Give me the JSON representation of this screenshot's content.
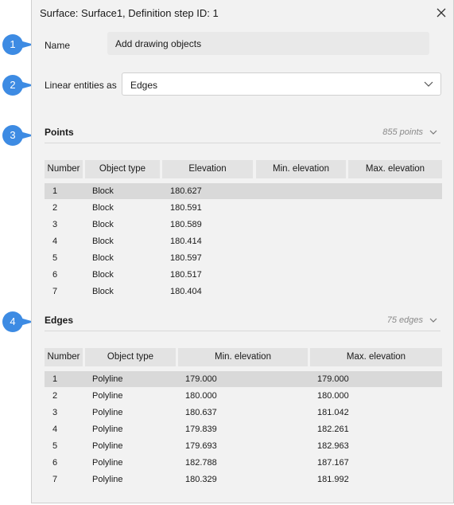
{
  "dialog": {
    "title": "Surface: Surface1, Definition step ID: 1",
    "name_label": "Name",
    "name_value": "Add drawing objects",
    "linear_label": "Linear entities as",
    "linear_value": "Edges"
  },
  "callouts": [
    "1",
    "2",
    "3",
    "4"
  ],
  "points": {
    "title": "Points",
    "count": "855 points",
    "columns": [
      "Number",
      "Object type",
      "Elevation",
      "Min. elevation",
      "Max. elevation"
    ],
    "rows": [
      [
        "1",
        "Block",
        "180.627"
      ],
      [
        "2",
        "Block",
        "180.591"
      ],
      [
        "3",
        "Block",
        "180.589"
      ],
      [
        "4",
        "Block",
        "180.414"
      ],
      [
        "5",
        "Block",
        "180.597"
      ],
      [
        "6",
        "Block",
        "180.517"
      ],
      [
        "7",
        "Block",
        "180.404"
      ]
    ]
  },
  "edges": {
    "title": "Edges",
    "count": "75 edges",
    "columns": [
      "Number",
      "Object type",
      "Min. elevation",
      "Max. elevation"
    ],
    "rows": [
      [
        "1",
        "Polyline",
        "179.000",
        "179.000"
      ],
      [
        "2",
        "Polyline",
        "180.000",
        "180.000"
      ],
      [
        "3",
        "Polyline",
        "180.637",
        "181.042"
      ],
      [
        "4",
        "Polyline",
        "179.839",
        "182.261"
      ],
      [
        "5",
        "Polyline",
        "179.693",
        "182.963"
      ],
      [
        "6",
        "Polyline",
        "182.788",
        "187.167"
      ],
      [
        "7",
        "Polyline",
        "180.329",
        "181.992"
      ]
    ]
  },
  "colors": {
    "accent": "#3d8be3",
    "selected_row": "#d9d9d9",
    "header": "#e3e3e3"
  }
}
